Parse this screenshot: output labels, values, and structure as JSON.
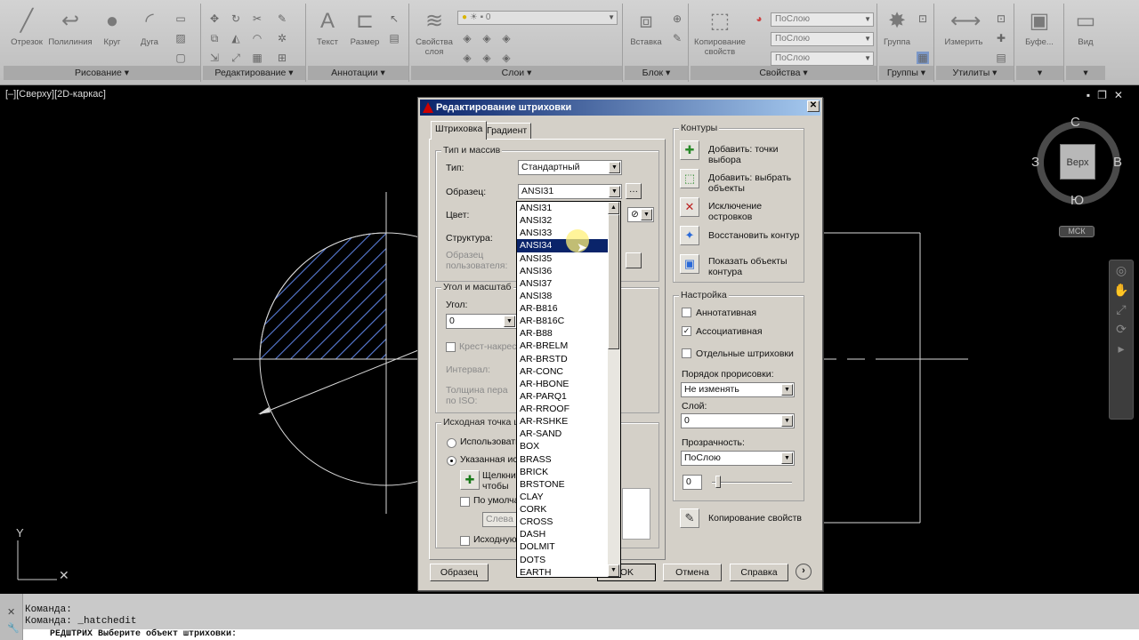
{
  "ribbon": {
    "panels": [
      {
        "label": "Рисование ▾",
        "tools": [
          "Отрезок",
          "Полилиния",
          "Круг",
          "Дуга"
        ]
      },
      {
        "label": "Редактирование ▾"
      },
      {
        "label": "Аннотации ▾",
        "tools": [
          "Текст",
          "Размер"
        ]
      },
      {
        "label": "Слои ▾",
        "tools": [
          "Свойства слоя"
        ],
        "layer_combo": "0"
      },
      {
        "label": "Блок ▾",
        "tools": [
          "Вставка"
        ]
      },
      {
        "label": "Свойства ▾",
        "tools": [
          "Копирование свойств"
        ],
        "combos": [
          "ПоСлою",
          "ПоСлою",
          "ПоСлою"
        ]
      },
      {
        "label": "Группы ▾",
        "tools": [
          "Группа"
        ]
      },
      {
        "label": "Утилиты ▾",
        "tools": [
          "Измерить"
        ]
      },
      {
        "tools": [
          "Буфе..."
        ]
      },
      {
        "tools": [
          "Вид"
        ]
      }
    ]
  },
  "viewport": {
    "label": "[–][Сверху][2D-каркас]",
    "viewcube": {
      "face": "Верх",
      "n": "С",
      "s": "Ю",
      "w": "З",
      "e": "В",
      "ucs": "МСК"
    }
  },
  "command": {
    "lines": [
      "Команда:",
      "Команда: _hatchedit"
    ],
    "prompt": "РЕДШТРИХ Выберите объект штриховки:"
  },
  "dialog": {
    "title": "Редактирование штриховки",
    "tabs": [
      "Штриховка",
      "Градиент"
    ],
    "type_group": {
      "title": "Тип и массив",
      "type_label": "Тип:",
      "type_value": "Стандартный",
      "pattern_label": "Образец:",
      "pattern_value": "ANSI31",
      "color_label": "Цвет:",
      "structure_label": "Структура:",
      "user_pattern_label": "Образец пользователя:"
    },
    "angle_group": {
      "title": "Угол и масштаб",
      "angle_label": "Угол:",
      "angle_value": "0",
      "cross_label": "Крест-накрест",
      "spacing_label": "Интервал:",
      "pen_label": "Толщина пера по ISO:"
    },
    "origin_group": {
      "title": "Исходная точка штриховки",
      "use_current": "Использовать текущую",
      "specified": "Указанная исходная точка",
      "click_set": "Щелкните, чтобы задать исходную",
      "default_extents": "По умолчанию",
      "bottom_left": "Слева внизу",
      "store_default": "Исходную точку"
    },
    "contours": {
      "title": "Контуры",
      "add_pick": "Добавить: точки выбора",
      "add_select": "Добавить: выбрать объекты",
      "remove_islands": "Исключение островков",
      "recreate": "Восстановить контур",
      "view_selections": "Показать объекты контура"
    },
    "settings": {
      "title": "Настройка",
      "annotative": "Аннотативная",
      "associative": "Ассоциативная",
      "separate": "Отдельные штриховки",
      "draw_order_label": "Порядок прорисовки:",
      "draw_order_value": "Не изменять",
      "layer_label": "Слой:",
      "layer_value": "0",
      "transparency_label": "Прозрачность:",
      "transparency_value": "ПоСлою",
      "transparency_amount": "0"
    },
    "inherit": "Копирование свойств",
    "buttons": {
      "preview": "Образец",
      "ok": "OK",
      "cancel": "Отмена",
      "help": "Справка"
    },
    "pattern_list": [
      "ANSI31",
      "ANSI32",
      "ANSI33",
      "ANSI34",
      "ANSI35",
      "ANSI36",
      "ANSI37",
      "ANSI38",
      "AR-B816",
      "AR-B816C",
      "AR-B88",
      "AR-BRELM",
      "AR-BRSTD",
      "AR-CONC",
      "AR-HBONE",
      "AR-PARQ1",
      "AR-RROOF",
      "AR-RSHKE",
      "AR-SAND",
      "BOX",
      "BRASS",
      "BRICK",
      "BRSTONE",
      "CLAY",
      "CORK",
      "CROSS",
      "DASH",
      "DOLMIT",
      "DOTS",
      "EARTH"
    ],
    "selected_pattern_index": 3
  },
  "colors": {
    "hatch": "#5a7dd8",
    "selection": "#0a246a"
  }
}
